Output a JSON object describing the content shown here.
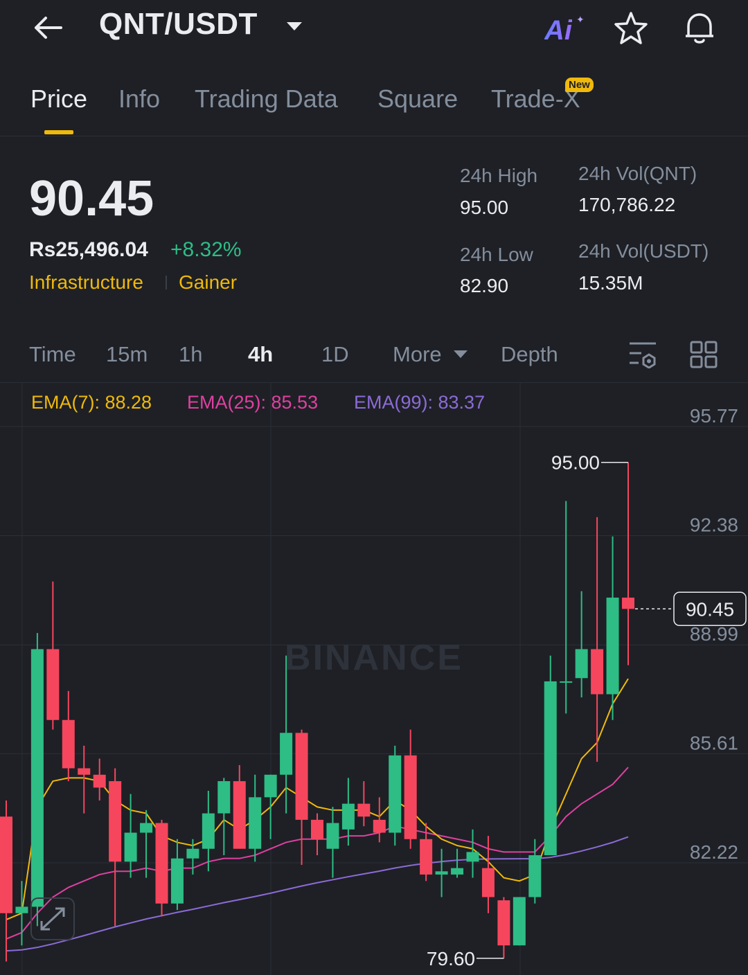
{
  "header": {
    "back_icon": "arrow-left-icon",
    "pair": "QNT/USDT",
    "ai_label": "Ai",
    "icons": [
      "chevron-down-icon",
      "ai-icon",
      "star-icon",
      "bell-icon"
    ]
  },
  "tabs": [
    {
      "label": "Price",
      "active": true
    },
    {
      "label": "Info"
    },
    {
      "label": "Trading Data"
    },
    {
      "label": "Square"
    },
    {
      "label": "Trade-X",
      "badge": "New"
    }
  ],
  "summary": {
    "last_price": "90.45",
    "fiat_price": "Rs25,496.04",
    "change": "+8.32%",
    "tags": [
      "Infrastructure",
      "Gainer"
    ],
    "stats": {
      "high_label": "24h High",
      "high": "95.00",
      "low_label": "24h Low",
      "low": "82.90",
      "vol_qnt_label": "24h Vol(QNT)",
      "vol_qnt": "170,786.22",
      "vol_usdt_label": "24h Vol(USDT)",
      "vol_usdt": "15.35M"
    }
  },
  "timeframes": {
    "items": [
      "Time",
      "15m",
      "1h",
      "4h",
      "1D",
      "More",
      "Depth"
    ],
    "active": "4h"
  },
  "indicators": {
    "ema7": "EMA(7): 88.28",
    "ema25": "EMA(25): 85.53",
    "ema99": "EMA(99): 83.37"
  },
  "colors": {
    "up": "#2ebd85",
    "down": "#f6465d",
    "ema7": "#f0b90b",
    "ema25": "#e040a0",
    "ema99": "#8c6bd6",
    "accent": "#f0b90b"
  },
  "chart_data": {
    "type": "candlestick",
    "watermark": "BINANCE",
    "y_ticks": [
      95.77,
      92.38,
      88.99,
      85.61,
      82.22
    ],
    "ylim": [
      78.0,
      96.3
    ],
    "current_price": 90.45,
    "high_marker": 95.0,
    "low_marker": 79.6,
    "candles": [
      {
        "o": 84.0,
        "h": 84.5,
        "l": 79.5,
        "c": 81.0
      },
      {
        "o": 81.0,
        "h": 82.0,
        "l": 80.0,
        "c": 81.2
      },
      {
        "o": 81.2,
        "h": 89.7,
        "l": 80.6,
        "c": 89.2
      },
      {
        "o": 89.2,
        "h": 91.3,
        "l": 86.7,
        "c": 87.0
      },
      {
        "o": 87.0,
        "h": 87.9,
        "l": 85.1,
        "c": 85.5
      },
      {
        "o": 85.5,
        "h": 86.2,
        "l": 84.1,
        "c": 85.3
      },
      {
        "o": 85.3,
        "h": 85.8,
        "l": 84.5,
        "c": 84.9
      },
      {
        "o": 85.1,
        "h": 85.5,
        "l": 80.6,
        "c": 82.6
      },
      {
        "o": 82.6,
        "h": 84.7,
        "l": 82.1,
        "c": 83.5
      },
      {
        "o": 83.5,
        "h": 84.2,
        "l": 82.1,
        "c": 83.8
      },
      {
        "o": 83.8,
        "h": 83.9,
        "l": 80.9,
        "c": 81.3
      },
      {
        "o": 81.3,
        "h": 83.3,
        "l": 81.1,
        "c": 82.7
      },
      {
        "o": 82.7,
        "h": 83.3,
        "l": 82.2,
        "c": 83.0
      },
      {
        "o": 83.0,
        "h": 84.8,
        "l": 82.3,
        "c": 84.1
      },
      {
        "o": 84.1,
        "h": 85.2,
        "l": 82.8,
        "c": 85.1
      },
      {
        "o": 85.1,
        "h": 85.6,
        "l": 83.6,
        "c": 83.0
      },
      {
        "o": 83.0,
        "h": 85.3,
        "l": 82.6,
        "c": 84.6
      },
      {
        "o": 84.6,
        "h": 85.3,
        "l": 83.3,
        "c": 85.3
      },
      {
        "o": 85.3,
        "h": 89.0,
        "l": 84.1,
        "c": 86.6
      },
      {
        "o": 86.6,
        "h": 86.7,
        "l": 82.5,
        "c": 83.9
      },
      {
        "o": 83.9,
        "h": 84.1,
        "l": 82.8,
        "c": 83.3
      },
      {
        "o": 83.0,
        "h": 84.3,
        "l": 82.1,
        "c": 83.8
      },
      {
        "o": 83.6,
        "h": 85.2,
        "l": 83.1,
        "c": 84.4
      },
      {
        "o": 84.4,
        "h": 85.1,
        "l": 83.7,
        "c": 84.0
      },
      {
        "o": 83.9,
        "h": 84.6,
        "l": 83.2,
        "c": 83.5
      },
      {
        "o": 83.5,
        "h": 86.2,
        "l": 83.1,
        "c": 85.9
      },
      {
        "o": 85.9,
        "h": 86.7,
        "l": 83.0,
        "c": 83.3
      },
      {
        "o": 83.3,
        "h": 83.8,
        "l": 82.0,
        "c": 82.2
      },
      {
        "o": 82.2,
        "h": 83.0,
        "l": 81.5,
        "c": 82.3
      },
      {
        "o": 82.2,
        "h": 83.0,
        "l": 82.1,
        "c": 82.4
      },
      {
        "o": 82.6,
        "h": 83.6,
        "l": 82.1,
        "c": 82.9
      },
      {
        "o": 82.4,
        "h": 83.4,
        "l": 81.0,
        "c": 81.5
      },
      {
        "o": 81.4,
        "h": 81.5,
        "l": 79.6,
        "c": 80.0
      },
      {
        "o": 80.0,
        "h": 81.5,
        "l": 80.0,
        "c": 81.5
      },
      {
        "o": 81.5,
        "h": 83.3,
        "l": 81.3,
        "c": 82.8
      },
      {
        "o": 82.8,
        "h": 89.0,
        "l": 82.8,
        "c": 88.2
      },
      {
        "o": 88.2,
        "h": 93.8,
        "l": 87.2,
        "c": 88.2
      },
      {
        "o": 88.3,
        "h": 91.0,
        "l": 87.7,
        "c": 89.2
      },
      {
        "o": 89.2,
        "h": 93.3,
        "l": 85.7,
        "c": 87.8
      },
      {
        "o": 87.8,
        "h": 92.7,
        "l": 87.0,
        "c": 90.8
      },
      {
        "o": 90.8,
        "h": 95.0,
        "l": 88.7,
        "c": 90.45
      }
    ],
    "ema7": [
      80.8,
      81.0,
      84.3,
      85.1,
      85.2,
      85.2,
      85.1,
      84.5,
      84.2,
      84.1,
      83.4,
      83.2,
      83.1,
      83.3,
      83.9,
      83.6,
      83.9,
      84.3,
      84.9,
      84.6,
      84.3,
      84.2,
      84.2,
      84.2,
      84.0,
      84.5,
      84.2,
      83.7,
      83.3,
      83.1,
      83.0,
      82.6,
      82.1,
      82.0,
      82.2,
      83.6,
      84.7,
      85.8,
      86.3,
      87.5,
      88.28
    ],
    "ema25": [
      80.2,
      80.4,
      81.0,
      81.5,
      81.8,
      82.0,
      82.2,
      82.3,
      82.3,
      82.4,
      82.3,
      82.4,
      82.4,
      82.6,
      82.7,
      82.7,
      82.8,
      83.0,
      83.2,
      83.3,
      83.3,
      83.3,
      83.4,
      83.4,
      83.5,
      83.7,
      83.6,
      83.5,
      83.4,
      83.3,
      83.2,
      83.0,
      82.9,
      82.9,
      82.9,
      83.4,
      84.0,
      84.4,
      84.7,
      85.0,
      85.53
    ]
  }
}
